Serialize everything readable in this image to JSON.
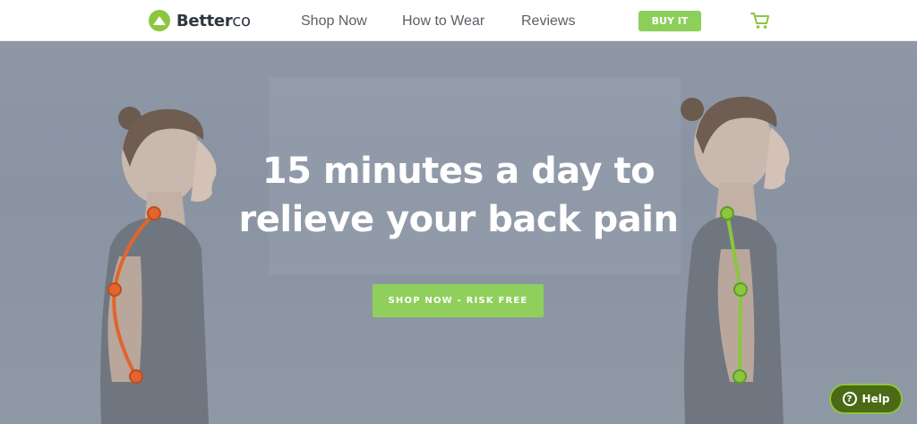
{
  "brand": {
    "name_bold": "Better",
    "name_light": "co",
    "accent": "#8cc63e"
  },
  "nav": {
    "items": [
      {
        "label": "Shop Now"
      },
      {
        "label": "How to Wear"
      },
      {
        "label": "Reviews"
      }
    ],
    "buy_label": "BUY IT",
    "cart_icon": "shopping-cart-icon"
  },
  "hero": {
    "headline_line1": "15 minutes a day to",
    "headline_line2": "relieve your back pain",
    "cta_label": "SHOP NOW - RISK FREE",
    "posture_colors": {
      "bad": "#e0652e",
      "good": "#8cc63e"
    }
  },
  "help": {
    "label": "Help",
    "icon": "question-circle-icon"
  }
}
